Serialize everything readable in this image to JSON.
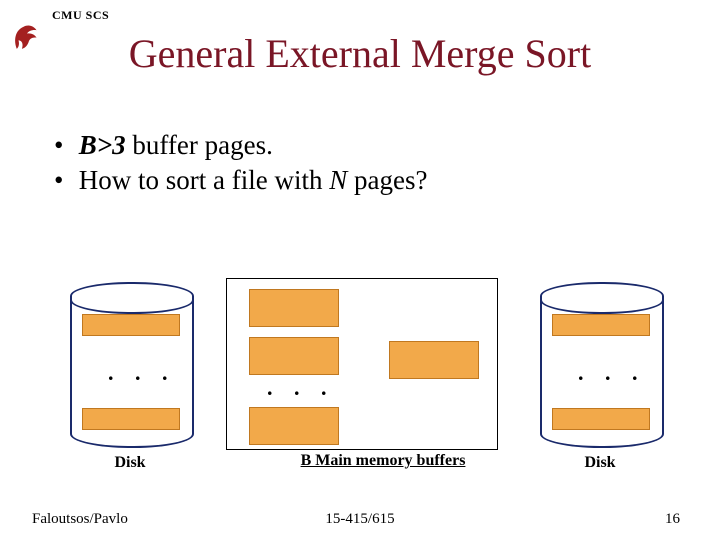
{
  "header": {
    "org": "CMU SCS"
  },
  "title": "General External Merge Sort",
  "bullets": {
    "b1_emph": "B>3",
    "b1_rest": " buffer pages.",
    "b2_pre": "How to sort a file with ",
    "b2_var": "N",
    "b2_post": " pages?"
  },
  "diagram": {
    "left_disk_label": "Disk",
    "right_disk_label": "Disk",
    "mem_label": "B Main memory buffers",
    "ellipsis": ". . ."
  },
  "footer": {
    "authors": "Faloutsos/Pavlo",
    "course": "15-415/615",
    "page": "16"
  }
}
